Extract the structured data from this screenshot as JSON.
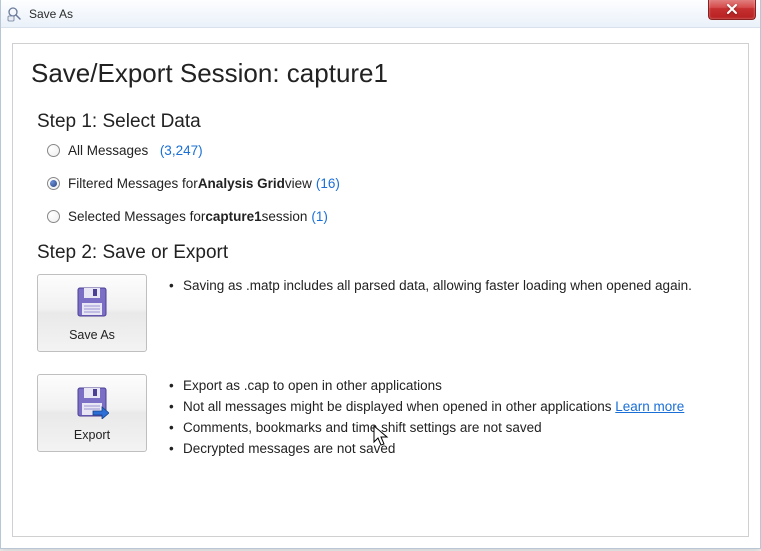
{
  "titlebar": {
    "title": "Save As"
  },
  "page": {
    "title": "Save/Export Session:  capture1"
  },
  "step1": {
    "heading": "Step 1: Select Data",
    "options": {
      "all": {
        "label": "All Messages",
        "count": "(3,247)",
        "checked": false
      },
      "filtered": {
        "prefix": "Filtered Messages for ",
        "bold": "Analysis Grid",
        "suffix": " view ",
        "count": "(16)",
        "checked": true
      },
      "selected": {
        "prefix": "Selected Messages for ",
        "bold": "capture1",
        "suffix": " session ",
        "count": "(1)",
        "checked": false
      }
    }
  },
  "step2": {
    "heading": "Step 2: Save or Export",
    "saveas": {
      "button": "Save As",
      "bullets": [
        "Saving as .matp includes all parsed data, allowing faster loading when opened again."
      ]
    },
    "export": {
      "button": "Export",
      "bullets": [
        "Export as .cap to open in other applications",
        "Not all messages might be displayed when opened in other applications ",
        "Comments, bookmarks and time shift settings are not saved",
        "Decrypted messages are not saved"
      ],
      "learn_more": "Learn more"
    }
  }
}
